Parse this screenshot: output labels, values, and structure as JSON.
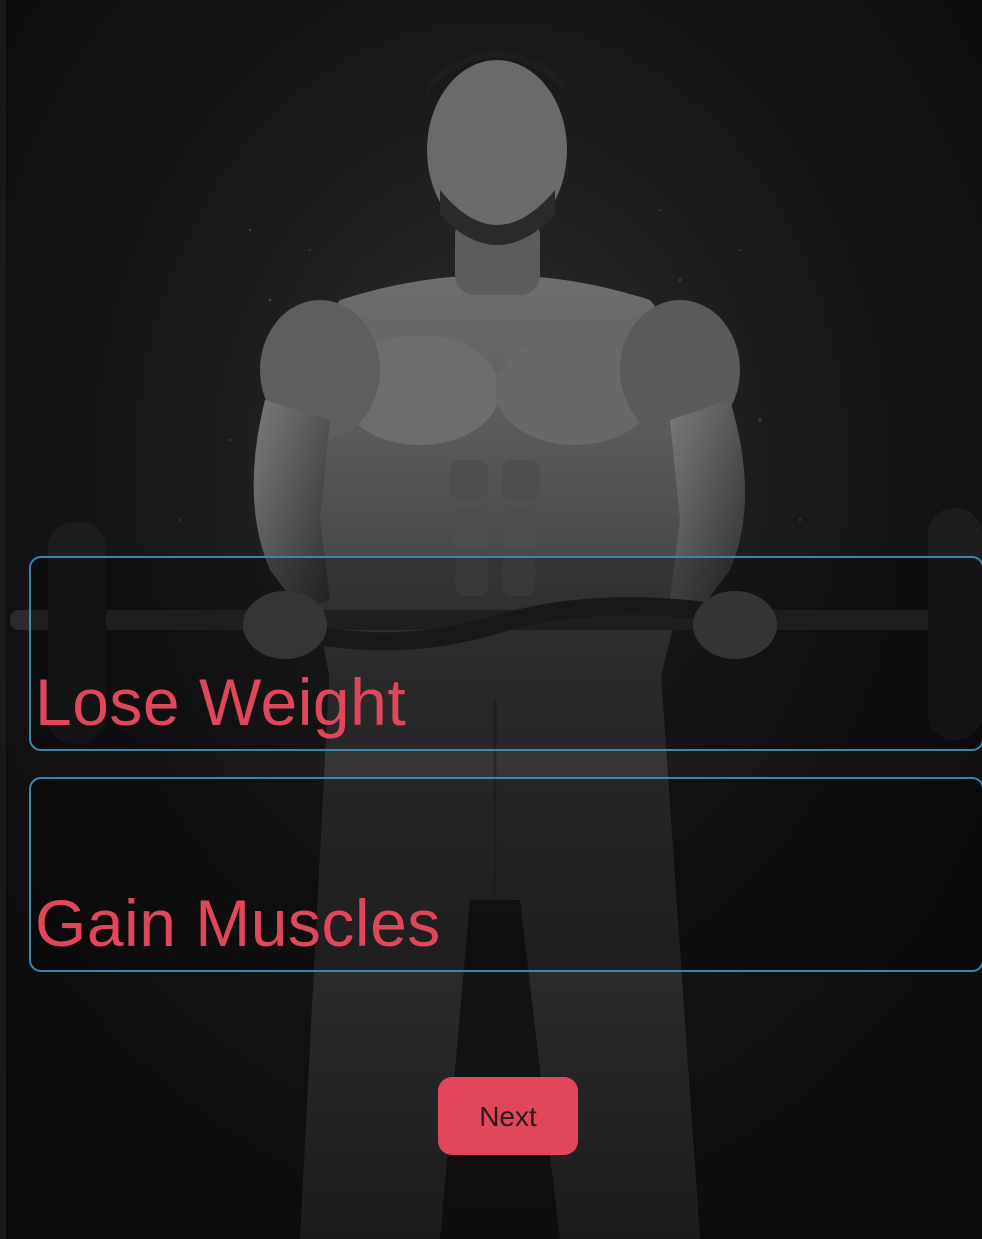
{
  "options": [
    {
      "id": "lose-weight",
      "label": "Lose Weight"
    },
    {
      "id": "gain-muscles",
      "label": "Gain Muscles"
    }
  ],
  "actions": {
    "next_label": "Next"
  },
  "background": {
    "image_subject": "athlete-holding-barbell"
  },
  "colors": {
    "accent": "#e0475c",
    "card_border": "#3a86b0",
    "background": "#111112"
  }
}
